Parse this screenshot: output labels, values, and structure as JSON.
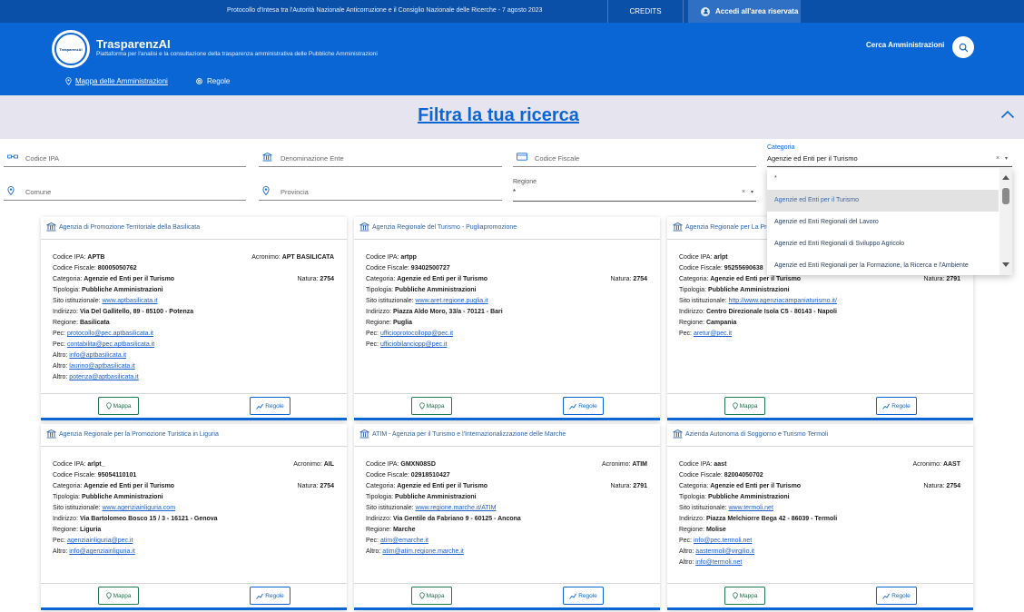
{
  "topbar": {
    "protocol": "Protocollo d'Intesa tra l'Autorità Nazionale Anticorruzione e il Consiglio Nazionale delle Ricerche - 7 agosto 2023",
    "credits": "CREDITS",
    "access": "Accedi all'area riservata"
  },
  "header": {
    "logo_text": "TrasparenzAI",
    "brand": "TrasparenzAI",
    "tagline": "Piattaforma per l'analisi e la consultazione della trasparenza amministrativa delle Pubbliche Amministrazioni",
    "search_label": "Cerca Amministrazioni",
    "nav_map": "Mappa delle Amministrazioni",
    "nav_rules": "Regole"
  },
  "filter": {
    "title": "Filtra la tua ricerca",
    "codice_ipa": "Codice IPA",
    "denominazione": "Denominazione Ente",
    "codice_fiscale": "Codice Fiscale",
    "categoria_label": "Categoria",
    "categoria_value": "Agenzie ed Enti per il Turismo",
    "comune": "Comune",
    "provincia": "Provincia",
    "regione_label": "Regione",
    "regione_value": "*"
  },
  "dropdown": {
    "items": [
      "*",
      "Agenzie ed Enti per il Turismo",
      "Agenzie ed Enti Regionali del Lavoro",
      "Agenzie ed Enti Regionali di Sviluppo Agricolo",
      "Agenzie ed Enti Regionali per la Formazione, la Ricerca e l'Ambiente"
    ],
    "selected_index": 1
  },
  "labels": {
    "codice_ipa": "Codice IPA: ",
    "acronimo": "Acronimo: ",
    "codice_fiscale": "Codice Fiscale: ",
    "categoria": "Categoria: ",
    "natura": "Natura: ",
    "tipologia": "Tipologia: ",
    "sito": "Sito istituzionale: ",
    "indirizzo": "Indirizzo: ",
    "regione": "Regione: ",
    "pec": "Pec: ",
    "altro": "Altro: ",
    "btn_map": "Mappa",
    "btn_rules": "Regole"
  },
  "cards": [
    {
      "title": "Agenzia di Promozione Territoriale della Basilicata",
      "codice_ipa": "APTB",
      "acronimo": "APT BASILICATA",
      "codice_fiscale": "80005050762",
      "categoria": "Agenzie ed Enti per il Turismo",
      "natura": "2754",
      "tipologia": "Pubbliche Amministrazioni",
      "sito": "www.aptbasilicata.it",
      "indirizzo": "Via Del Gallitello, 89 - 85100 - Potenza",
      "regione": "Basilicata",
      "pec": [
        "protocollo@pec.aptbasilicata.it",
        "contabilita@pec.aptbasilicata.it"
      ],
      "altro": [
        "info@aptbasilicata.it",
        "laurino@aptbasilicata.it",
        "potenza@aptbasilicata.it"
      ]
    },
    {
      "title": "Agenzia Regionale del Turismo - Pugliapromozione",
      "codice_ipa": "artpp",
      "acronimo": "",
      "codice_fiscale": "93402500727",
      "categoria": "Agenzie ed Enti per il Turismo",
      "natura": "2754",
      "tipologia": "Pubbliche Amministrazioni",
      "sito": "www.aret.regione.puglia.it",
      "indirizzo": "Piazza Aldo Moro, 33/a - 70121 - Bari",
      "regione": "Puglia",
      "pec": [
        "ufficioprotocollopp@pec.it",
        "ufficiobilanciopp@pec.it"
      ],
      "altro": []
    },
    {
      "title": "Agenzia Regionale per La Promozione Turistica della Campania",
      "codice_ipa": "arlpt",
      "acronimo": "",
      "codice_fiscale": "95255690638",
      "categoria": "Agenzie ed Enti per il Turismo",
      "natura": "2791",
      "tipologia": "Pubbliche Amministrazioni",
      "sito": "http://www.agenziacampaniaturismo.it/",
      "indirizzo": "Centro Direzionale Isola C5 - 80143 - Napoli",
      "regione": "Campania",
      "pec": [
        "aretur@pec.it"
      ],
      "altro": []
    },
    {
      "title": "Agenzia Regionale per la Promozione Turistica in Liguria",
      "codice_ipa": "arlpt_",
      "acronimo": "AIL",
      "codice_fiscale": "95054110101",
      "categoria": "Agenzie ed Enti per il Turismo",
      "natura": "2754",
      "tipologia": "Pubbliche Amministrazioni",
      "sito": "www.agenziainliguria.com",
      "indirizzo": "Via Bartolomeo Bosco 15 / 3 - 16121 - Genova",
      "regione": "Liguria",
      "pec": [
        "agenziainliguria@pec.it"
      ],
      "altro": [
        "info@agenziainliguria.it"
      ]
    },
    {
      "title": "ATIM - Agenzia per il Turismo e l'Internazionalizzazione delle Marche",
      "codice_ipa": "GMXN08SD",
      "acronimo": "ATIM",
      "codice_fiscale": "02918510427",
      "categoria": "Agenzie ed Enti per il Turismo",
      "natura": "2791",
      "tipologia": "Pubbliche Amministrazioni",
      "sito": "www.regione.marche.it/ATIM",
      "indirizzo": "Via Gentile da Fabriano 9 - 60125 - Ancona",
      "regione": "Marche",
      "pec": [
        "atim@emarche.it"
      ],
      "altro": [
        "atim@atim.regione.marche.it"
      ]
    },
    {
      "title": "Azienda Autonoma di Soggiorno e Turismo Termoli",
      "codice_ipa": "aast",
      "acronimo": "AAST",
      "codice_fiscale": "82004050702",
      "categoria": "Agenzie ed Enti per il Turismo",
      "natura": "2754",
      "tipologia": "Pubbliche Amministrazioni",
      "sito": "www.termoli.net",
      "indirizzo": "Piazza Melchiorre Bega 42 - 86039 - Termoli",
      "regione": "Molise",
      "pec": [
        "info@pec.termoli.net"
      ],
      "altro": [
        "aastermoli@virgilio.it",
        "info@termoli.net"
      ]
    }
  ],
  "colors": {
    "primary": "#0b66d5",
    "topbar": "#0a4fa8",
    "band": "#e6e4ee",
    "link": "#1a5ec9",
    "map_btn": "#1e7a4f"
  }
}
